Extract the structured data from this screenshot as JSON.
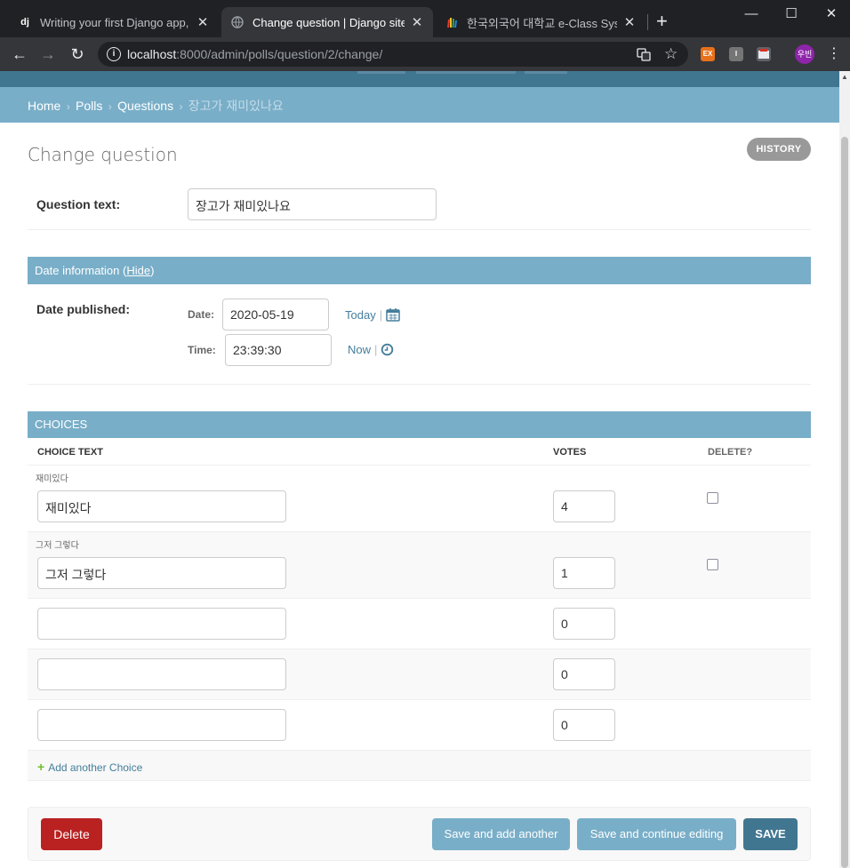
{
  "browser": {
    "tabs": [
      {
        "favicon": "dj",
        "title": "Writing your first Django app, p",
        "active": false
      },
      {
        "favicon": "globe-icon",
        "title": "Change question | Django site a",
        "active": true
      },
      {
        "favicon": "hufs-icon",
        "title": "한국외국어 대학교 e-Class Syste",
        "active": false
      }
    ],
    "url_host": "localhost",
    "url_rest": ":8000/admin/polls/question/2/change/",
    "profile_initials": "우빈",
    "extensions": [
      "EX",
      "I",
      "■"
    ]
  },
  "breadcrumbs": {
    "home": "Home",
    "app": "Polls",
    "model": "Questions",
    "current": "장고가 재미있나요"
  },
  "page": {
    "title": "Change question",
    "history_label": "HISTORY"
  },
  "question": {
    "label": "Question text:",
    "value": "장고가 재미있나요"
  },
  "date_info": {
    "heading": "Date information",
    "toggle_label": "Hide",
    "published_label": "Date published:",
    "date_label": "Date:",
    "date_value": "2020-05-19",
    "today_label": "Today",
    "time_label": "Time:",
    "time_value": "23:39:30",
    "now_label": "Now"
  },
  "choices": {
    "heading": "CHOICES",
    "col_text": "CHOICE TEXT",
    "col_votes": "VOTES",
    "col_delete": "DELETE?",
    "rows": [
      {
        "original": "재미있다",
        "text": "재미있다",
        "votes": "4",
        "deletable": true
      },
      {
        "original": "그저 그렇다",
        "text": "그저 그렇다",
        "votes": "1",
        "deletable": true
      },
      {
        "original": "",
        "text": "",
        "votes": "0",
        "deletable": false
      },
      {
        "original": "",
        "text": "",
        "votes": "0",
        "deletable": false
      },
      {
        "original": "",
        "text": "",
        "votes": "0",
        "deletable": false
      }
    ],
    "add_label": "Add another Choice"
  },
  "submit": {
    "delete_label": "Delete",
    "save_add_label": "Save and add another",
    "save_continue_label": "Save and continue editing",
    "save_label": "SAVE"
  },
  "colors": {
    "header": "#417690",
    "breadcrumb": "#79aec8",
    "link": "#447e9b",
    "delete": "#ba2121"
  }
}
